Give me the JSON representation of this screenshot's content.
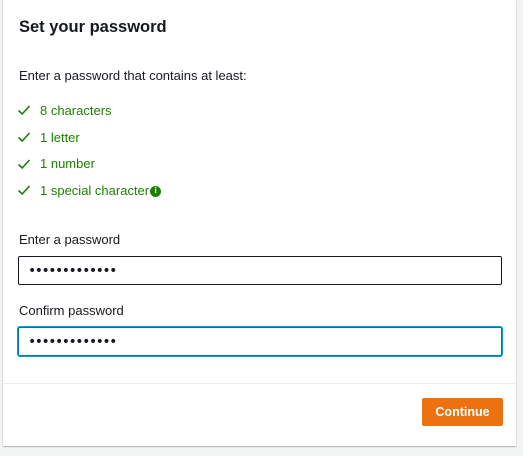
{
  "dialog": {
    "title": "Set your password",
    "intro": "Enter a password that contains at least:",
    "requirements": [
      {
        "label": "8 characters",
        "status": "met"
      },
      {
        "label": "1 letter",
        "status": "met"
      },
      {
        "label": "1 number",
        "status": "met"
      },
      {
        "label": "1 special character",
        "status": "met",
        "icon": "info-icon"
      }
    ],
    "password_label": "Enter a password",
    "password_value": "•••••••••••••",
    "confirm_label": "Confirm password",
    "confirm_value": "•••••••••••••",
    "continue_label": "Continue"
  },
  "colors": {
    "success": "#1d8102",
    "accent": "#ec7211",
    "focus": "#0073bb"
  }
}
